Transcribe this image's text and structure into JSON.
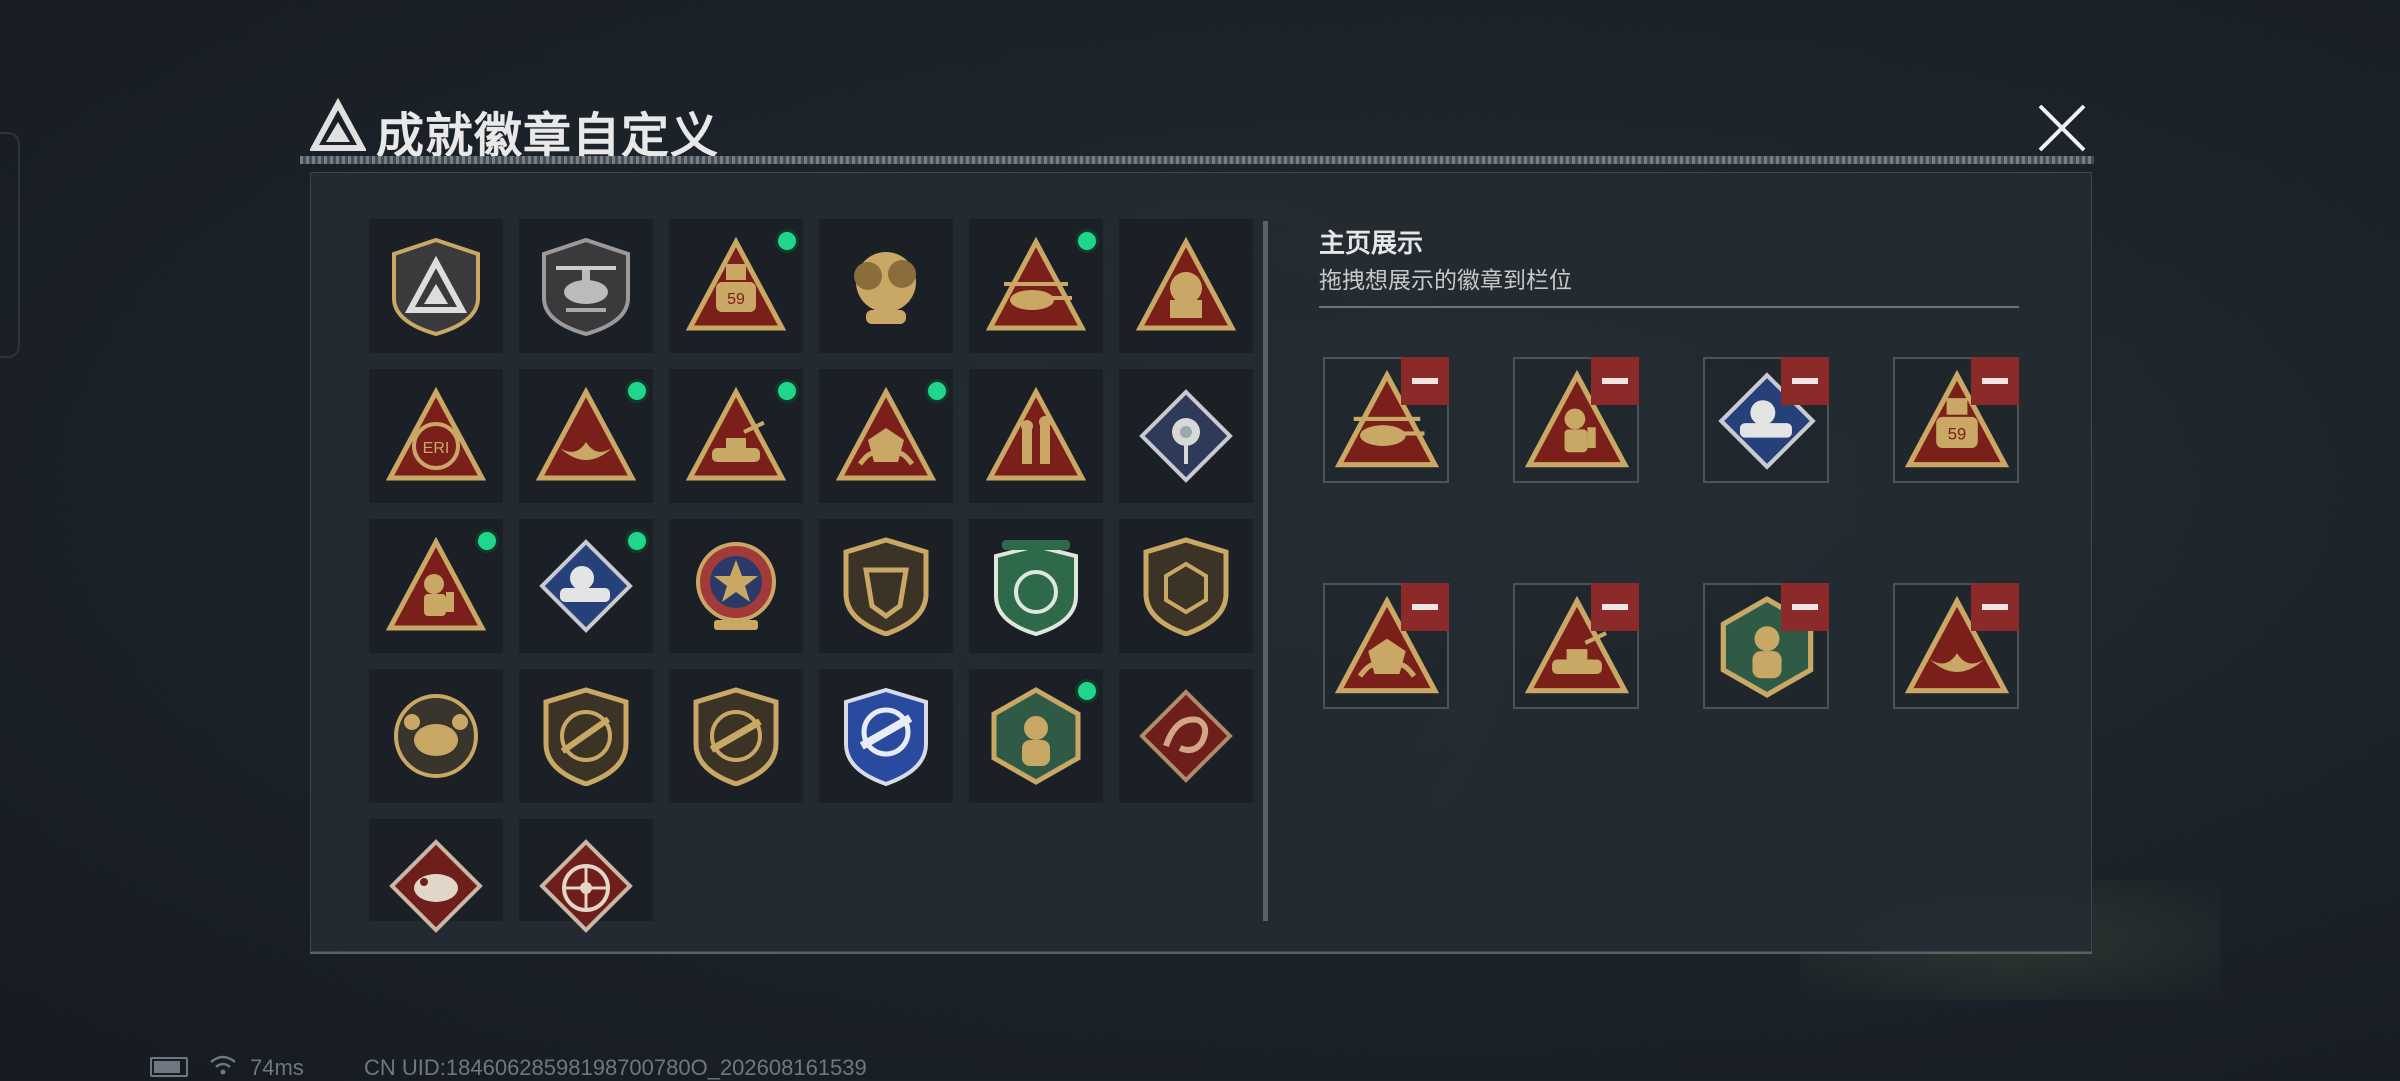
{
  "title": "成就徽章自定义",
  "right_panel": {
    "title": "主页展示",
    "subtitle": "拖拽想展示的徽章到栏位"
  },
  "badges": [
    {
      "icon": "delta-shield-badge",
      "new": false
    },
    {
      "icon": "helicopter-shield-badge",
      "new": false
    },
    {
      "icon": "operator-59-badge",
      "new": true
    },
    {
      "icon": "explosion-badge",
      "new": false
    },
    {
      "icon": "helicopter-badge",
      "new": true
    },
    {
      "icon": "pilot-helmet-badge",
      "new": false
    },
    {
      "icon": "globe-eri-badge",
      "new": false
    },
    {
      "icon": "hands-badge",
      "new": true
    },
    {
      "icon": "tank-badge",
      "new": true
    },
    {
      "icon": "dice-badge",
      "new": true
    },
    {
      "icon": "soldiers-badge",
      "new": false
    },
    {
      "icon": "rose-badge",
      "new": false
    },
    {
      "icon": "diver-badge",
      "new": true
    },
    {
      "icon": "blue-tank-badge",
      "new": true
    },
    {
      "icon": "star-medal-badge",
      "new": false
    },
    {
      "icon": "shield-emblem-badge",
      "new": false
    },
    {
      "icon": "green-shield-badge",
      "new": false
    },
    {
      "icon": "dice-shield-badge",
      "new": false
    },
    {
      "icon": "crab-badge",
      "new": false
    },
    {
      "icon": "rifle-shield-badge",
      "new": false
    },
    {
      "icon": "smg-shield-badge",
      "new": false
    },
    {
      "icon": "blue-crest-badge",
      "new": false
    },
    {
      "icon": "green-hex-badge",
      "new": true
    },
    {
      "icon": "dragon-badge",
      "new": false
    },
    {
      "icon": "komodo-badge",
      "new": false
    },
    {
      "icon": "wheel-badge",
      "new": false
    }
  ],
  "display_slots": [
    {
      "icon": "helicopter-badge"
    },
    {
      "icon": "diver-badge"
    },
    {
      "icon": "blue-tank-badge"
    },
    {
      "icon": "operator-59-badge"
    },
    {
      "icon": "dice-badge"
    },
    {
      "icon": "tank-badge"
    },
    {
      "icon": "green-hex-badge"
    },
    {
      "icon": "hands-badge"
    }
  ],
  "status_bar": {
    "ping": "74ms",
    "uid": "CN UID:18460628598198700780O_202608161539"
  }
}
